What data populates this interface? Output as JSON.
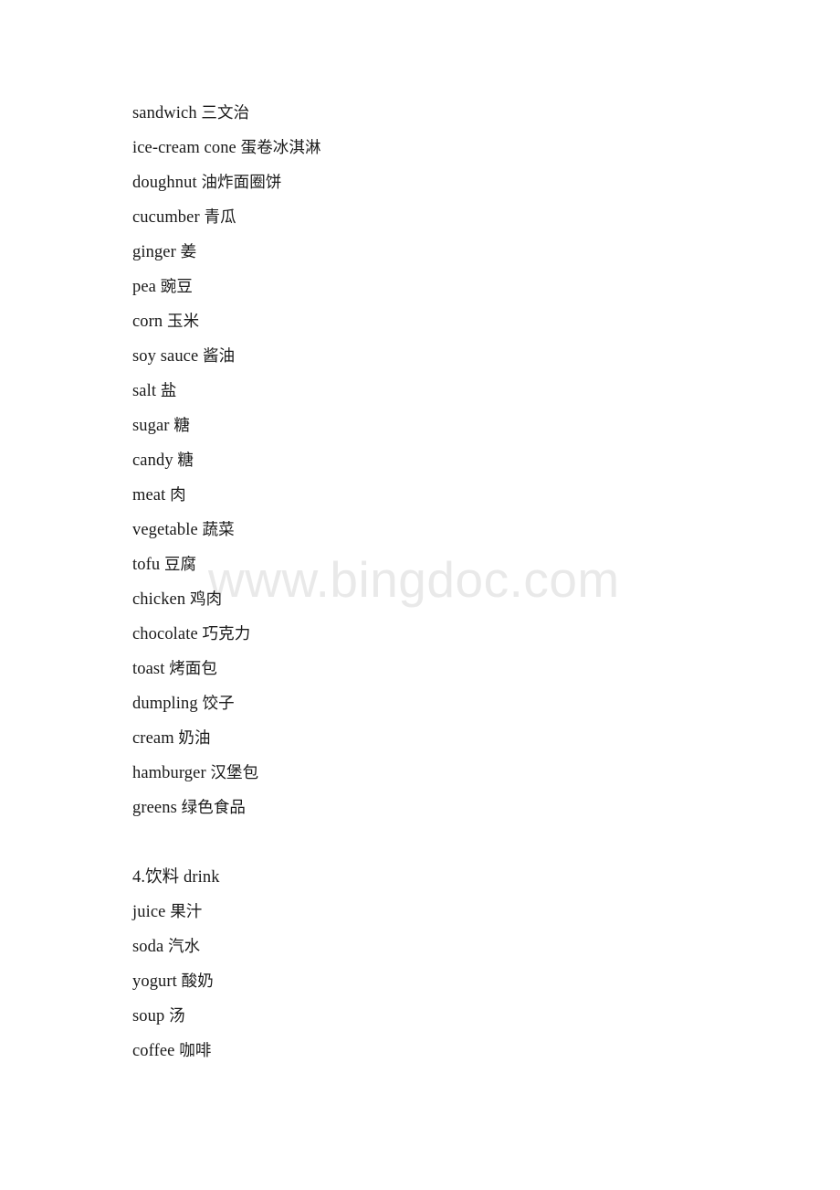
{
  "document": {
    "watermark": "www.bingdoc.com",
    "watermark_color": "#e9e9e9",
    "text_color": "#1a1a1a",
    "background_color": "#ffffff"
  },
  "content": {
    "food_entries": [
      {
        "term": "sandwich",
        "gloss": "三文治"
      },
      {
        "term": "ice-cream cone",
        "gloss": "蛋卷冰淇淋"
      },
      {
        "term": "doughnut",
        "gloss": "油炸面圈饼"
      },
      {
        "term": "cucumber",
        "gloss": "青瓜"
      },
      {
        "term": "ginger",
        "gloss": "姜"
      },
      {
        "term": "pea",
        "gloss": "豌豆"
      },
      {
        "term": "corn",
        "gloss": "玉米"
      },
      {
        "term": "soy sauce",
        "gloss": "酱油"
      },
      {
        "term": "salt",
        "gloss": "盐"
      },
      {
        "term": "sugar",
        "gloss": "糖"
      },
      {
        "term": "candy",
        "gloss": "糖"
      },
      {
        "term": "meat",
        "gloss": "肉"
      },
      {
        "term": "vegetable",
        "gloss": "蔬菜"
      },
      {
        "term": "tofu",
        "gloss": "豆腐"
      },
      {
        "term": "chicken",
        "gloss": "鸡肉"
      },
      {
        "term": "chocolate",
        "gloss": "巧克力"
      },
      {
        "term": "toast",
        "gloss": "烤面包"
      },
      {
        "term": "dumpling",
        "gloss": "饺子"
      },
      {
        "term": "cream",
        "gloss": "奶油"
      },
      {
        "term": "hamburger",
        "gloss": "汉堡包"
      },
      {
        "term": "greens",
        "gloss": "绿色食品"
      }
    ],
    "drink_section": {
      "heading": "4.饮料 drink",
      "entries": [
        {
          "term": "juice",
          "gloss": "果汁"
        },
        {
          "term": "soda",
          "gloss": "汽水"
        },
        {
          "term": "yogurt",
          "gloss": "酸奶"
        },
        {
          "term": "soup",
          "gloss": "汤"
        },
        {
          "term": "coffee",
          "gloss": "咖啡"
        }
      ]
    }
  }
}
